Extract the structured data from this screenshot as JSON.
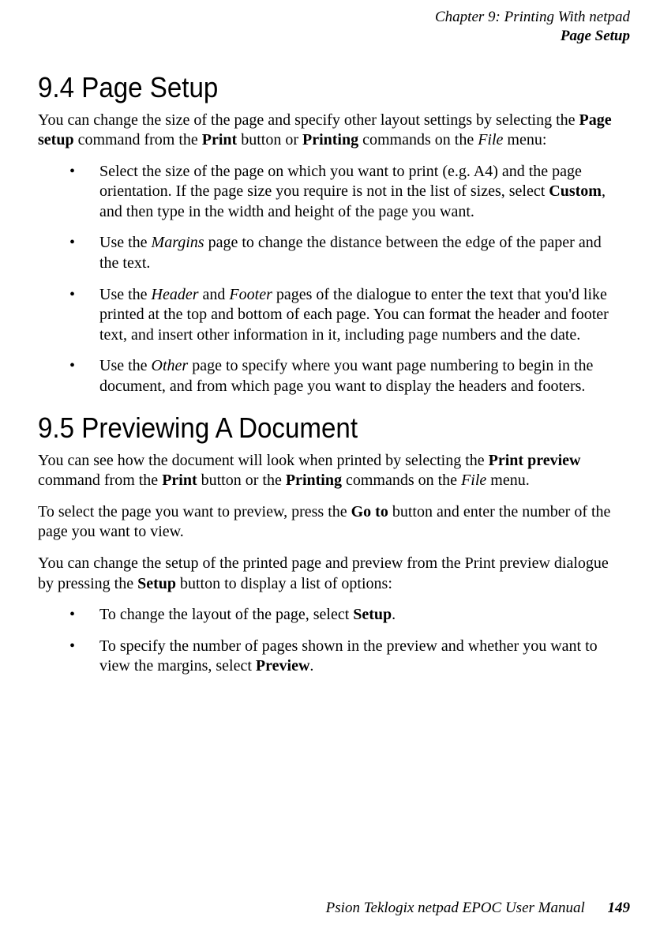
{
  "header": {
    "chapter_line": "Chapter 9:  Printing With netpad",
    "section_line": "Page Setup"
  },
  "section94": {
    "heading": "9.4  Page Setup",
    "intro_parts": {
      "t1": "You can change the size of the page and specify other layout settings by selecting the ",
      "b1": "Page setup",
      "t2": " command from the ",
      "b2": "Print",
      "t3": " button or ",
      "b3": "Printing",
      "t4": " commands on the ",
      "i1": "File",
      "t5": " menu:"
    },
    "bullets": {
      "b1": {
        "t1": "Select the size of the page on which you want to print (e.g. A4) and the page orientation. If the page size you require is not in the list of sizes, select ",
        "bold1": "Custom",
        "t2": ", and then type in the width and height of the page you want."
      },
      "b2": {
        "t1": "Use the ",
        "i1": "Margins",
        "t2": " page to change the distance between the edge of the paper and the text."
      },
      "b3": {
        "t1": "Use the ",
        "i1": "Header",
        "t2": " and ",
        "i2": "Footer",
        "t3": " pages of the dialogue to enter the text that you'd like printed at the top and bottom of each page. You can format the header and footer text, and insert other information in it, including page numbers and the date."
      },
      "b4": {
        "t1": "Use the ",
        "i1": "Other",
        "t2": " page to specify where you want page numbering to begin in the document, and from which page you want to display the headers and footers."
      }
    }
  },
  "section95": {
    "heading": "9.5  Previewing A Document",
    "para1": {
      "t1": "You can see how the document will look when printed by selecting the ",
      "b1": "Print preview",
      "t2": " command from the ",
      "b2": "Print",
      "t3": " button or the ",
      "b3": "Printing",
      "t4": " commands on the ",
      "i1": "File",
      "t5": " menu."
    },
    "para2": {
      "t1": "To select the page you want to preview, press the ",
      "b1": "Go to",
      "t2": " button and enter the number of the page you want to view."
    },
    "para3": {
      "t1": "You can change the setup of the printed page and preview from the Print preview dialogue by pressing the ",
      "b1": "Setup",
      "t2": " button to display a list of options:"
    },
    "bullets": {
      "b1": {
        "t1": "To change the layout of the page, select ",
        "bold1": "Setup",
        "t2": "."
      },
      "b2": {
        "t1": "To specify the number of pages shown in the preview and whether you want to view the margins, select ",
        "bold1": "Preview",
        "t2": "."
      }
    }
  },
  "footer": {
    "manual_title": "Psion Teklogix netpad EPOC User Manual",
    "page_number": "149"
  }
}
